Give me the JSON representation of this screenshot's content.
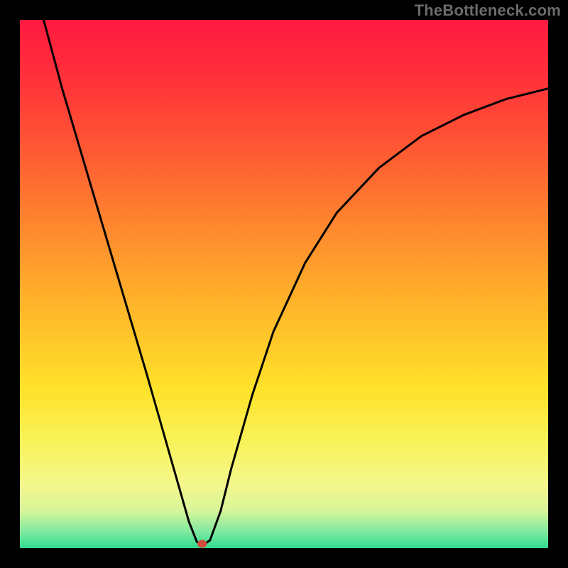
{
  "watermark": "TheBottleneck.com",
  "chart_data": {
    "type": "line",
    "title": "",
    "xlabel": "",
    "ylabel": "",
    "xlim": [
      0,
      100
    ],
    "ylim": [
      0,
      100
    ],
    "grid": false,
    "legend": false,
    "background_gradient": {
      "stops": [
        {
          "offset": 0.0,
          "color": "#ff1a40"
        },
        {
          "offset": 0.1,
          "color": "#ff2e3a"
        },
        {
          "offset": 0.25,
          "color": "#ff5a33"
        },
        {
          "offset": 0.4,
          "color": "#ff8a2e"
        },
        {
          "offset": 0.55,
          "color": "#ffb82a"
        },
        {
          "offset": 0.7,
          "color": "#ffe22a"
        },
        {
          "offset": 0.8,
          "color": "#f8f35a"
        },
        {
          "offset": 0.88,
          "color": "#f4f78c"
        },
        {
          "offset": 0.93,
          "color": "#d6f59a"
        },
        {
          "offset": 0.97,
          "color": "#7de8a0"
        },
        {
          "offset": 1.0,
          "color": "#2fdc8f"
        }
      ]
    },
    "series": [
      {
        "name": "bottleneck-curve",
        "xy": [
          [
            4.5,
            100.0
          ],
          [
            8.0,
            87.0
          ],
          [
            12.0,
            73.5
          ],
          [
            16.0,
            60.0
          ],
          [
            20.0,
            46.5
          ],
          [
            24.0,
            33.0
          ],
          [
            27.0,
            22.5
          ],
          [
            30.0,
            12.0
          ],
          [
            32.0,
            5.0
          ],
          [
            33.5,
            1.2
          ],
          [
            34.0,
            0.8
          ],
          [
            35.0,
            0.8
          ],
          [
            36.0,
            1.5
          ],
          [
            38.0,
            7.0
          ],
          [
            40.0,
            15.0
          ],
          [
            44.0,
            29.0
          ],
          [
            48.0,
            41.0
          ],
          [
            54.0,
            54.0
          ],
          [
            60.0,
            63.5
          ],
          [
            68.0,
            72.0
          ],
          [
            76.0,
            78.0
          ],
          [
            84.0,
            82.0
          ],
          [
            92.0,
            85.0
          ],
          [
            100.0,
            87.0
          ]
        ]
      }
    ],
    "marker": {
      "name": "optimal-point",
      "x": 34.5,
      "y": 0.8,
      "color": "#d24b3f"
    }
  }
}
